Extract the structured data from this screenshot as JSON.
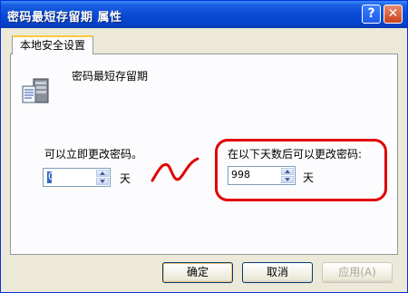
{
  "window": {
    "title": "密码最短存留期 属性",
    "help_label": "?",
    "close_label": "✕"
  },
  "tabs": [
    {
      "label": "本地安全设置",
      "selected": true
    }
  ],
  "policy": {
    "name": "密码最短存留期",
    "icon": "server-policy-icon"
  },
  "options": {
    "immediate_label": "可以立即更改密码。",
    "immediate_value": "0",
    "immediate_unit": "天",
    "days_label": "在以下天数后可以更改密码:",
    "days_value": "998",
    "days_unit": "天"
  },
  "buttons": {
    "ok": "确定",
    "cancel": "取消",
    "apply": "应用(A)"
  },
  "annotation_color": "#e00000"
}
